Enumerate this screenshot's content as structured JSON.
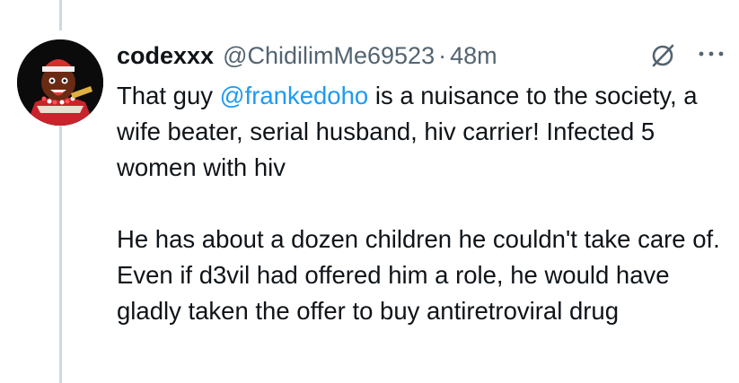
{
  "tweet": {
    "author_name": "codexxx",
    "author_handle": "@ChidilimMe69523",
    "separator": "·",
    "time": "48m",
    "text_part1_prefix": "That guy ",
    "mention": "@frankedoho",
    "text_part1_suffix": " is a nuisance to the society, a wife beater,  serial husband, hiv carrier! Infected 5 women with hiv",
    "text_part2": "He has about a dozen children he couldn't take care of. Even if d3vil had offered him a role, he would have gladly taken the offer to buy antiretroviral drug"
  },
  "icons": {
    "grok": "grok-icon",
    "more": "more-options-icon",
    "avatar": "avatar-image"
  },
  "colors": {
    "text": "#0f1419",
    "secondary": "#536471",
    "link": "#1d9bf0",
    "thread_line": "#cfd9de"
  }
}
